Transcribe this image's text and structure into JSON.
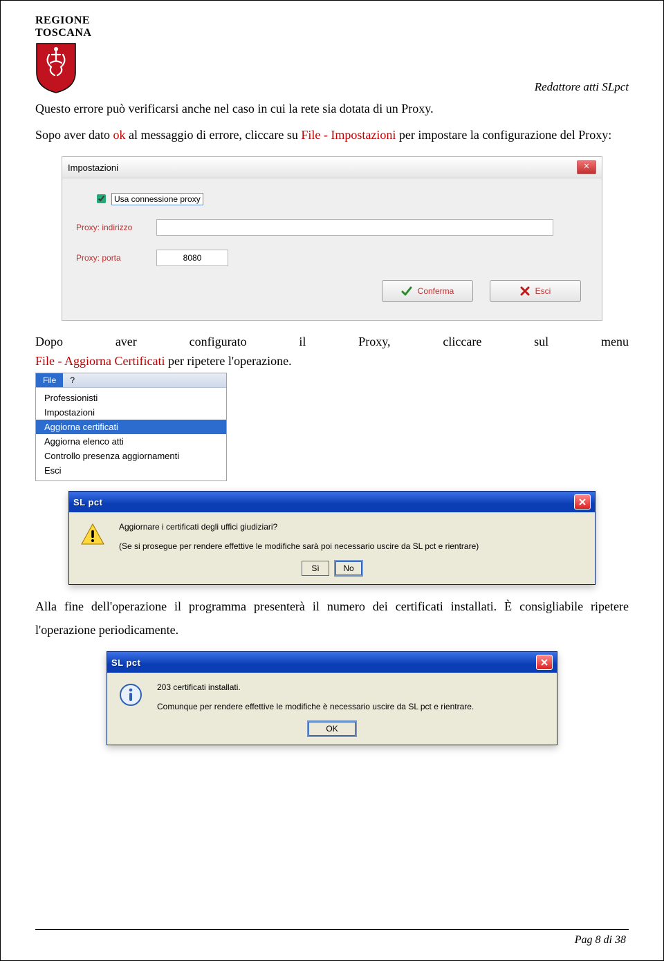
{
  "header": {
    "region_line1": "REGIONE",
    "region_line2": "TOSCANA",
    "doc_title": "Redattore atti SLpct"
  },
  "body": {
    "p1_a": "Questo errore può verificarsi anche nel caso in cui la rete sia dotata di un Proxy.",
    "p2_pre": "Sopo aver dato ",
    "p2_ok": "ok",
    "p2_mid": " al messaggio di errore, cliccare su  ",
    "p2_link": "File - Impostazioni",
    "p2_post": " per impostare la configurazione del Proxy:",
    "p3": {
      "w1": "Dopo",
      "w2": "aver",
      "w3": "configurato",
      "w4": "il",
      "w5": "Proxy,",
      "w6": "cliccare",
      "w7": "sul",
      "w8": "menu"
    },
    "p4_link": "File - Aggiorna Certificati",
    "p4_post": " per ripetere l'operazione.",
    "p5": "Alla fine dell'operazione il programma presenterà il numero dei certificati installati. È consigliabile ripetere l'operazione periodicamente."
  },
  "dlg_imp": {
    "title": "Impostazioni",
    "chk": "Usa connessione proxy",
    "lbl_addr": "Proxy: indirizzo",
    "lbl_port": "Proxy: porta",
    "val_port": "8080",
    "btn_ok": "Conferma",
    "btn_esc": "Esci"
  },
  "menu": {
    "file": "File",
    "help": "?",
    "items": [
      "Professionisti",
      "Impostazioni",
      "Aggiorna certificati",
      "Aggiorna elenco atti",
      "Controllo presenza aggiornamenti",
      "Esci"
    ],
    "selected_index": 2
  },
  "dlg_confirm": {
    "title": "SL pct",
    "line1": "Aggiornare i certificati degli uffici giudiziari?",
    "line2": "(Se si prosegue per rendere effettive le modifiche sarà poi necessario uscire da SL pct e rientrare)",
    "btn_yes": "Sì",
    "btn_no": "No"
  },
  "dlg_info": {
    "title": "SL pct",
    "line1": "203 certificati installati.",
    "line2": "Comunque per rendere effettive le modifiche è necessario uscire da SL pct e rientrare.",
    "btn_ok": "OK"
  },
  "footer": {
    "page": "Pag 8 di 38"
  }
}
